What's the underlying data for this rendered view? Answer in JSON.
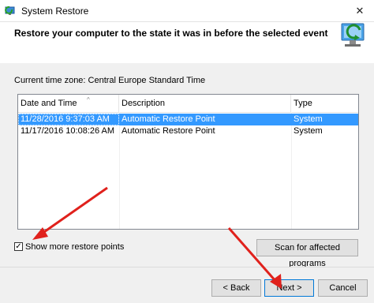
{
  "window": {
    "title": "System Restore",
    "close_glyph": "✕"
  },
  "header": {
    "heading": "Restore your computer to the state it was in before the selected event"
  },
  "timezone": "Current time zone: Central Europe Standard Time",
  "table": {
    "columns": [
      "Date and Time",
      "Description",
      "Type"
    ],
    "rows": [
      {
        "date": "11/28/2016 9:37:03 AM",
        "description": "Automatic Restore Point",
        "type": "System",
        "selected": true
      },
      {
        "date": "11/17/2016 10:08:26 AM",
        "description": "Automatic Restore Point",
        "type": "System",
        "selected": false
      }
    ]
  },
  "show_more": {
    "label": "Show more restore points",
    "checked": true,
    "check_glyph": "✓"
  },
  "buttons": {
    "scan": "Scan for affected programs",
    "back": "< Back",
    "next": "Next >",
    "cancel": "Cancel"
  },
  "icons": {
    "app": "system-restore-icon",
    "header": "system-restore-large-icon",
    "sort": "sort-up-icon"
  },
  "colors": {
    "selection": "#3399ff",
    "arrow": "#e0211c",
    "accent": "#0078d7"
  }
}
